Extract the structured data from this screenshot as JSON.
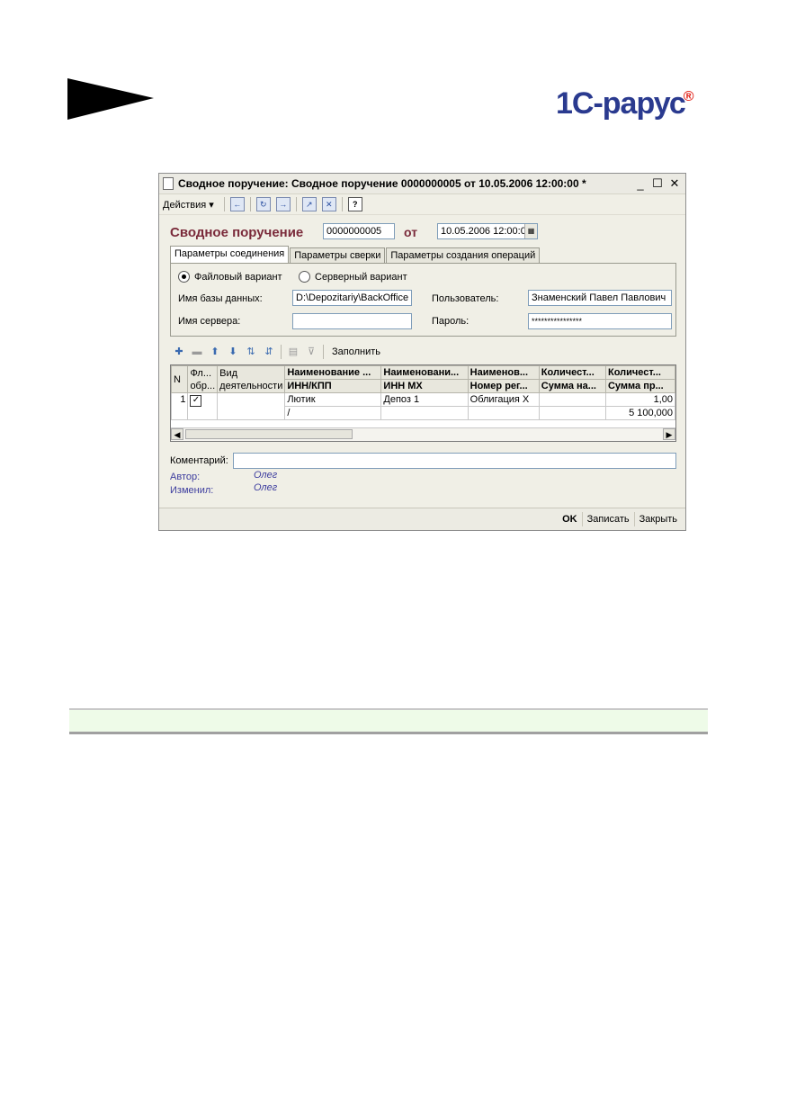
{
  "logo": {
    "text": "1С-рарус",
    "sup": "®"
  },
  "window": {
    "title": "Сводное поручение: Сводное поручение 0000000005 от 10.05.2006 12:00:00 *",
    "minimize": "_",
    "maximize": "☐",
    "close": "✕"
  },
  "toolbar": {
    "actions_label": "Действия ▾"
  },
  "form": {
    "title": "Сводное поручение",
    "number": "0000000005",
    "ot_label": "от",
    "date": "10.05.2006 12:00:0"
  },
  "tabs": [
    "Параметры соединения",
    "Параметры сверки",
    "Параметры создания операций"
  ],
  "connection": {
    "file_variant": "Файловый вариант",
    "server_variant": "Серверный вариант",
    "db_name_label": "Имя базы данных:",
    "db_name_value": "D:\\Depozitariy\\BackOffice",
    "user_label": "Пользователь:",
    "user_value": "Знаменский Павел Павлович",
    "server_label": "Имя сервера:",
    "server_value": "",
    "password_label": "Пароль:",
    "password_value": "****************"
  },
  "grid_toolbar": {
    "fill_label": "Заполнить"
  },
  "grid": {
    "headers_row1": [
      "N",
      "Фл... обр...",
      "Вид деятельности",
      "Наименование ...",
      "Наименовани...",
      "Наименов...",
      "Количест...",
      "Количест..."
    ],
    "headers_row2": [
      "ИНН/КПП",
      "ИНН МХ",
      "Номер рег...",
      "Сумма на...",
      "Сумма пр..."
    ],
    "rows": [
      {
        "n": "1",
        "checked": "✓",
        "vid": "",
        "c1": "Лютик",
        "c2": "Депоз 1",
        "c3": "Облигация Х",
        "c4": "",
        "c5": "1,00"
      },
      {
        "c1": "/",
        "c2": "",
        "c3": "",
        "c4": "",
        "c5": "5 100,000"
      }
    ]
  },
  "comment": {
    "label": "Коментарий:",
    "value": ""
  },
  "meta": {
    "author_label": "Автор:",
    "author_value": "Олег",
    "changed_label": "Изменил:",
    "changed_value": "Олег"
  },
  "footer": {
    "ok": "OK",
    "save": "Записать",
    "close": "Закрыть"
  },
  "colors": {
    "form_title": "#7a2a3a",
    "meta_text": "#3c3c9e",
    "green_bar": "#eefbe8"
  }
}
